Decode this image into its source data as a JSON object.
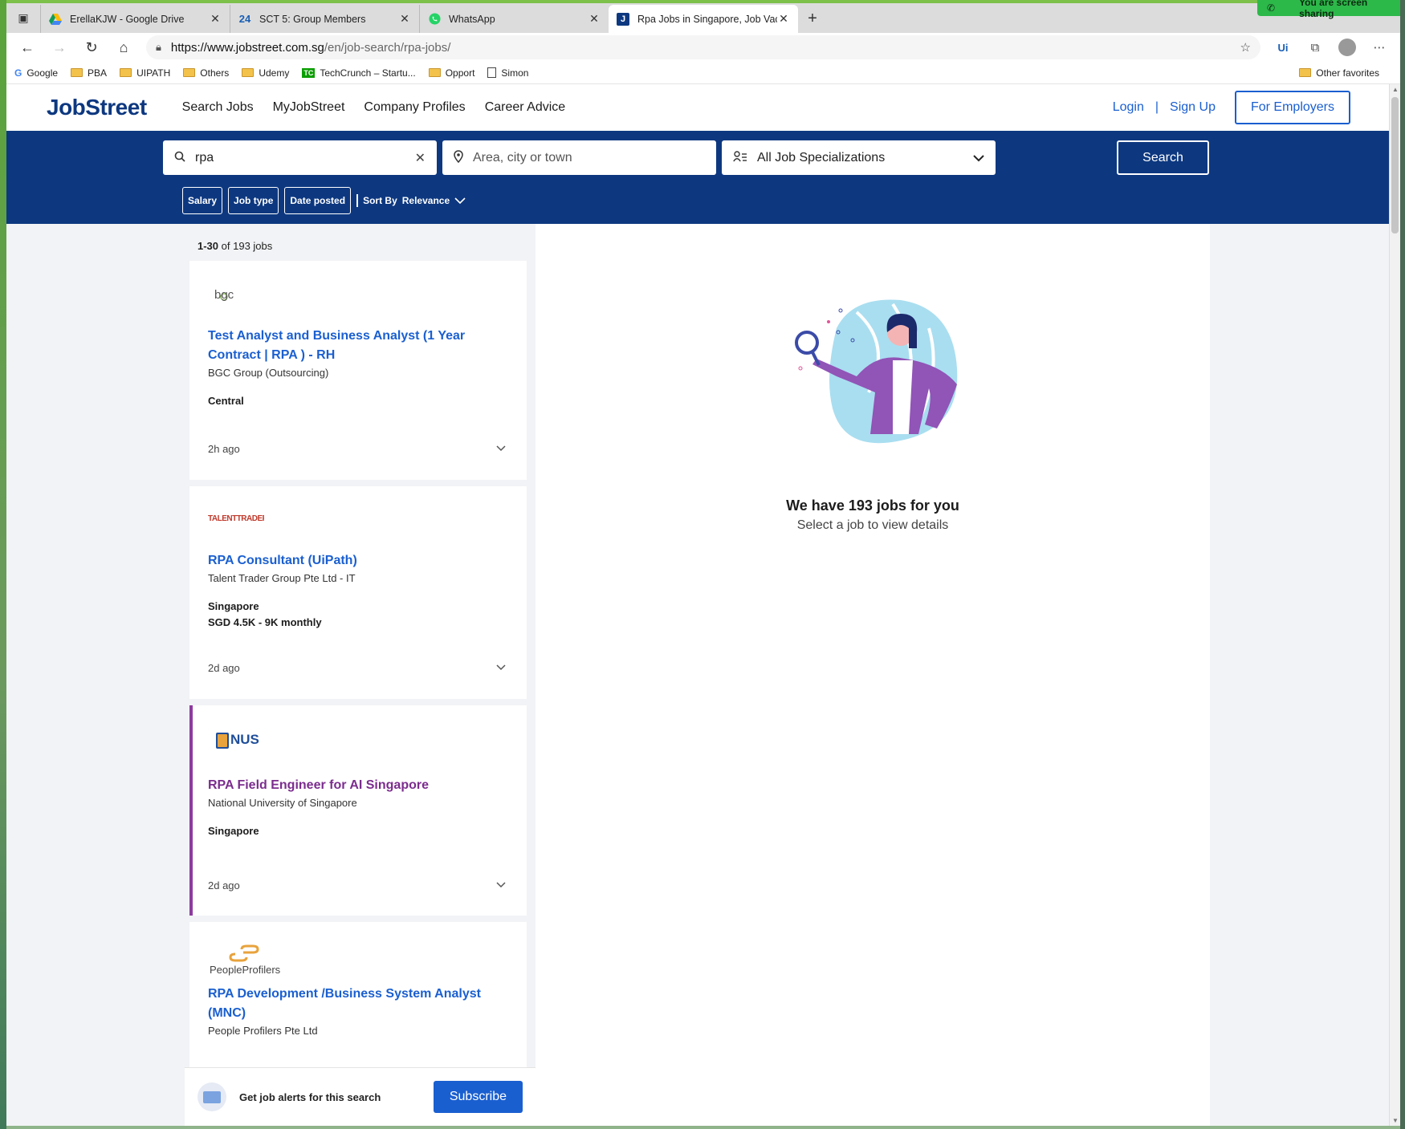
{
  "screen_share": {
    "label": "You are screen sharing"
  },
  "tabs": [
    {
      "title": "ErellaKJW - Google Drive",
      "icon": "google-drive-icon"
    },
    {
      "title": "SCT 5: Group Members",
      "icon": "24"
    },
    {
      "title": "WhatsApp",
      "icon": "whatsapp-icon"
    },
    {
      "title": "Rpa Jobs in Singapore, Job Vacan",
      "icon": "J"
    }
  ],
  "address": {
    "host": "https://www.jobstreet.com.sg",
    "path": "/en/job-search/rpa-jobs/"
  },
  "toolbar": {
    "ui_label": "Ui"
  },
  "bookmarks": [
    "Google",
    "PBA",
    "UIPATH",
    "Others",
    "Udemy",
    "TechCrunch – Startu...",
    "Opport",
    "Simon"
  ],
  "bookmarks_other": "Other favorites",
  "header": {
    "logo": "JobStreet",
    "nav": [
      "Search Jobs",
      "MyJobStreet",
      "Company Profiles",
      "Career Advice"
    ],
    "login": "Login",
    "separator": "|",
    "signup": "Sign Up",
    "employers": "For Employers"
  },
  "search": {
    "keyword": "rpa",
    "location_placeholder": "Area, city or town",
    "specialization": "All Job Specializations",
    "button": "Search"
  },
  "filters": {
    "salary": "Salary",
    "job_type": "Job type",
    "date_posted": "Date posted",
    "sort_prefix": "Sort By",
    "sort_value": "Relevance"
  },
  "results": {
    "range": "1-30",
    "of_text": "of 193 jobs"
  },
  "jobs": [
    {
      "logo_text": "bgc",
      "title_line1": "Test Analyst and Business Analyst (1 Year",
      "title_line2": "Contract | RPA ) - RH",
      "company": "BGC Group (Outsourcing)",
      "location": "Central",
      "salary": "",
      "posted": "2h ago"
    },
    {
      "logo_text": "TALENTTRADER",
      "title_line1": "RPA Consultant (UiPath)",
      "title_line2": "",
      "company": "Talent Trader Group Pte Ltd - IT",
      "location": "Singapore",
      "salary": "SGD 4.5K - 9K monthly",
      "posted": "2d ago"
    },
    {
      "logo_text": "NUS",
      "title_line1": "RPA Field Engineer for AI Singapore",
      "title_line2": "",
      "company": "National University of Singapore",
      "location": "Singapore",
      "salary": "",
      "posted": "2d ago"
    },
    {
      "logo_text": "PeopleProfilers",
      "title_line1": "RPA Development /Business System Analyst",
      "title_line2": "(MNC)",
      "company": "People Profilers Pte Ltd",
      "location": "",
      "salary": "",
      "posted": ""
    }
  ],
  "detail": {
    "headline": "We have 193 jobs for you",
    "subtext": "Select a job to view details"
  },
  "alert": {
    "text": "Get job alerts for this search",
    "button": "Subscribe"
  },
  "colors": {
    "brand_navy": "#0d3880",
    "link_blue": "#1a5fd0",
    "visited_purple": "#7b2d8e"
  }
}
